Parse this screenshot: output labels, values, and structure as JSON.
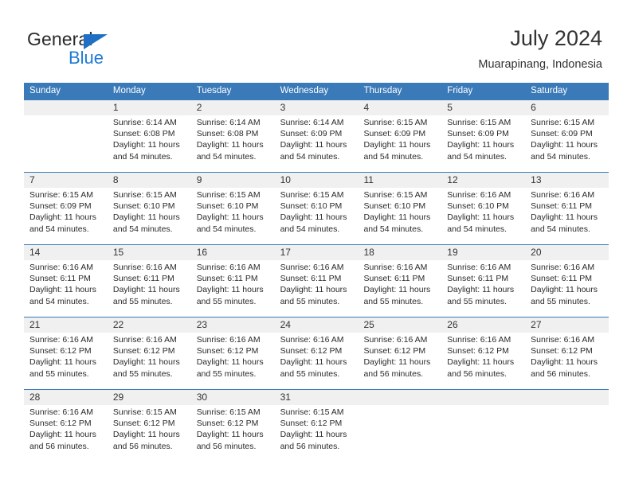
{
  "brand": {
    "name_part1": "General",
    "name_part2": "Blue",
    "triangle_icon": "triangle-logo-icon"
  },
  "header": {
    "title": "July 2024",
    "subtitle": "Muarapinang, Indonesia"
  },
  "calendar": {
    "weekday_headers": [
      "Sunday",
      "Monday",
      "Tuesday",
      "Wednesday",
      "Thursday",
      "Friday",
      "Saturday"
    ],
    "colors": {
      "header_blue": "#3a7ab8",
      "row_gray": "#f0f0f0",
      "brand_blue": "#1f7ad4",
      "text": "#333333"
    },
    "weeks": [
      {
        "days": [
          {
            "date": "",
            "sunrise": "",
            "sunset": "",
            "daylight_line1": "",
            "daylight_line2": ""
          },
          {
            "date": "1",
            "sunrise": "Sunrise: 6:14 AM",
            "sunset": "Sunset: 6:08 PM",
            "daylight_line1": "Daylight: 11 hours",
            "daylight_line2": "and 54 minutes."
          },
          {
            "date": "2",
            "sunrise": "Sunrise: 6:14 AM",
            "sunset": "Sunset: 6:08 PM",
            "daylight_line1": "Daylight: 11 hours",
            "daylight_line2": "and 54 minutes."
          },
          {
            "date": "3",
            "sunrise": "Sunrise: 6:14 AM",
            "sunset": "Sunset: 6:09 PM",
            "daylight_line1": "Daylight: 11 hours",
            "daylight_line2": "and 54 minutes."
          },
          {
            "date": "4",
            "sunrise": "Sunrise: 6:15 AM",
            "sunset": "Sunset: 6:09 PM",
            "daylight_line1": "Daylight: 11 hours",
            "daylight_line2": "and 54 minutes."
          },
          {
            "date": "5",
            "sunrise": "Sunrise: 6:15 AM",
            "sunset": "Sunset: 6:09 PM",
            "daylight_line1": "Daylight: 11 hours",
            "daylight_line2": "and 54 minutes."
          },
          {
            "date": "6",
            "sunrise": "Sunrise: 6:15 AM",
            "sunset": "Sunset: 6:09 PM",
            "daylight_line1": "Daylight: 11 hours",
            "daylight_line2": "and 54 minutes."
          }
        ]
      },
      {
        "days": [
          {
            "date": "7",
            "sunrise": "Sunrise: 6:15 AM",
            "sunset": "Sunset: 6:09 PM",
            "daylight_line1": "Daylight: 11 hours",
            "daylight_line2": "and 54 minutes."
          },
          {
            "date": "8",
            "sunrise": "Sunrise: 6:15 AM",
            "sunset": "Sunset: 6:10 PM",
            "daylight_line1": "Daylight: 11 hours",
            "daylight_line2": "and 54 minutes."
          },
          {
            "date": "9",
            "sunrise": "Sunrise: 6:15 AM",
            "sunset": "Sunset: 6:10 PM",
            "daylight_line1": "Daylight: 11 hours",
            "daylight_line2": "and 54 minutes."
          },
          {
            "date": "10",
            "sunrise": "Sunrise: 6:15 AM",
            "sunset": "Sunset: 6:10 PM",
            "daylight_line1": "Daylight: 11 hours",
            "daylight_line2": "and 54 minutes."
          },
          {
            "date": "11",
            "sunrise": "Sunrise: 6:15 AM",
            "sunset": "Sunset: 6:10 PM",
            "daylight_line1": "Daylight: 11 hours",
            "daylight_line2": "and 54 minutes."
          },
          {
            "date": "12",
            "sunrise": "Sunrise: 6:16 AM",
            "sunset": "Sunset: 6:10 PM",
            "daylight_line1": "Daylight: 11 hours",
            "daylight_line2": "and 54 minutes."
          },
          {
            "date": "13",
            "sunrise": "Sunrise: 6:16 AM",
            "sunset": "Sunset: 6:11 PM",
            "daylight_line1": "Daylight: 11 hours",
            "daylight_line2": "and 54 minutes."
          }
        ]
      },
      {
        "days": [
          {
            "date": "14",
            "sunrise": "Sunrise: 6:16 AM",
            "sunset": "Sunset: 6:11 PM",
            "daylight_line1": "Daylight: 11 hours",
            "daylight_line2": "and 54 minutes."
          },
          {
            "date": "15",
            "sunrise": "Sunrise: 6:16 AM",
            "sunset": "Sunset: 6:11 PM",
            "daylight_line1": "Daylight: 11 hours",
            "daylight_line2": "and 55 minutes."
          },
          {
            "date": "16",
            "sunrise": "Sunrise: 6:16 AM",
            "sunset": "Sunset: 6:11 PM",
            "daylight_line1": "Daylight: 11 hours",
            "daylight_line2": "and 55 minutes."
          },
          {
            "date": "17",
            "sunrise": "Sunrise: 6:16 AM",
            "sunset": "Sunset: 6:11 PM",
            "daylight_line1": "Daylight: 11 hours",
            "daylight_line2": "and 55 minutes."
          },
          {
            "date": "18",
            "sunrise": "Sunrise: 6:16 AM",
            "sunset": "Sunset: 6:11 PM",
            "daylight_line1": "Daylight: 11 hours",
            "daylight_line2": "and 55 minutes."
          },
          {
            "date": "19",
            "sunrise": "Sunrise: 6:16 AM",
            "sunset": "Sunset: 6:11 PM",
            "daylight_line1": "Daylight: 11 hours",
            "daylight_line2": "and 55 minutes."
          },
          {
            "date": "20",
            "sunrise": "Sunrise: 6:16 AM",
            "sunset": "Sunset: 6:11 PM",
            "daylight_line1": "Daylight: 11 hours",
            "daylight_line2": "and 55 minutes."
          }
        ]
      },
      {
        "days": [
          {
            "date": "21",
            "sunrise": "Sunrise: 6:16 AM",
            "sunset": "Sunset: 6:12 PM",
            "daylight_line1": "Daylight: 11 hours",
            "daylight_line2": "and 55 minutes."
          },
          {
            "date": "22",
            "sunrise": "Sunrise: 6:16 AM",
            "sunset": "Sunset: 6:12 PM",
            "daylight_line1": "Daylight: 11 hours",
            "daylight_line2": "and 55 minutes."
          },
          {
            "date": "23",
            "sunrise": "Sunrise: 6:16 AM",
            "sunset": "Sunset: 6:12 PM",
            "daylight_line1": "Daylight: 11 hours",
            "daylight_line2": "and 55 minutes."
          },
          {
            "date": "24",
            "sunrise": "Sunrise: 6:16 AM",
            "sunset": "Sunset: 6:12 PM",
            "daylight_line1": "Daylight: 11 hours",
            "daylight_line2": "and 55 minutes."
          },
          {
            "date": "25",
            "sunrise": "Sunrise: 6:16 AM",
            "sunset": "Sunset: 6:12 PM",
            "daylight_line1": "Daylight: 11 hours",
            "daylight_line2": "and 56 minutes."
          },
          {
            "date": "26",
            "sunrise": "Sunrise: 6:16 AM",
            "sunset": "Sunset: 6:12 PM",
            "daylight_line1": "Daylight: 11 hours",
            "daylight_line2": "and 56 minutes."
          },
          {
            "date": "27",
            "sunrise": "Sunrise: 6:16 AM",
            "sunset": "Sunset: 6:12 PM",
            "daylight_line1": "Daylight: 11 hours",
            "daylight_line2": "and 56 minutes."
          }
        ]
      },
      {
        "days": [
          {
            "date": "28",
            "sunrise": "Sunrise: 6:16 AM",
            "sunset": "Sunset: 6:12 PM",
            "daylight_line1": "Daylight: 11 hours",
            "daylight_line2": "and 56 minutes."
          },
          {
            "date": "29",
            "sunrise": "Sunrise: 6:15 AM",
            "sunset": "Sunset: 6:12 PM",
            "daylight_line1": "Daylight: 11 hours",
            "daylight_line2": "and 56 minutes."
          },
          {
            "date": "30",
            "sunrise": "Sunrise: 6:15 AM",
            "sunset": "Sunset: 6:12 PM",
            "daylight_line1": "Daylight: 11 hours",
            "daylight_line2": "and 56 minutes."
          },
          {
            "date": "31",
            "sunrise": "Sunrise: 6:15 AM",
            "sunset": "Sunset: 6:12 PM",
            "daylight_line1": "Daylight: 11 hours",
            "daylight_line2": "and 56 minutes."
          },
          {
            "date": "",
            "sunrise": "",
            "sunset": "",
            "daylight_line1": "",
            "daylight_line2": ""
          },
          {
            "date": "",
            "sunrise": "",
            "sunset": "",
            "daylight_line1": "",
            "daylight_line2": ""
          },
          {
            "date": "",
            "sunrise": "",
            "sunset": "",
            "daylight_line1": "",
            "daylight_line2": ""
          }
        ]
      }
    ]
  }
}
